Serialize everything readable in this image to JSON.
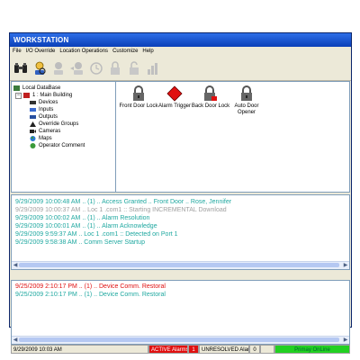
{
  "window": {
    "title": "WORKSTATION"
  },
  "menu": [
    "File",
    "I/O Override",
    "Location Operations",
    "Customize",
    "Help"
  ],
  "toolbar": {
    "buttons": [
      "binoculars-icon",
      "search-person-icon",
      "person-gear-icon",
      "person-arrow-icon",
      "clock-icon",
      "lock-icon",
      "lock-open-icon",
      "chart-icon"
    ]
  },
  "tree": {
    "root": "Local DataBase",
    "building": "1 : Main Building",
    "items": [
      "Devices",
      "Inputs",
      "Outputs",
      "Override Groups",
      "Cameras",
      "Maps",
      "Operator Comment"
    ]
  },
  "devices": [
    {
      "label": "Front Door Lock",
      "icon": "padlock-icon"
    },
    {
      "label": "Alarm Trigger",
      "icon": "alarm-diamond-icon"
    },
    {
      "label": "Back Door Lock",
      "icon": "padlock-alarm-icon"
    },
    {
      "label": "Auto Door Opener",
      "icon": "padlock-icon"
    }
  ],
  "events": [
    {
      "text": "9/29/2009 10:00:48 AM .. (1) .. Access Granted .. Front Door .. Rose, Jennifer",
      "color": "#1fa8a0"
    },
    {
      "text": "9/29/2009 10:00:37 AM .. Loc 1 .com1 :: Starting INCREMENTAL Download",
      "color": "#a0a0a0"
    },
    {
      "text": "9/29/2009 10:00:02 AM .. (1) .. Alarm Resolution",
      "color": "#1fa8a0"
    },
    {
      "text": "9/29/2009 10:00:01 AM .. (1) .. Alarm Acknowledge",
      "color": "#1fa8a0"
    },
    {
      "text": "9/29/2009 9:59:37 AM .. Loc 1 .com1 :: Detected on Port 1",
      "color": "#1fa8a0"
    },
    {
      "text": "9/29/2009 9:58:38 AM .. Comm Server Startup",
      "color": "#1fa8a0"
    }
  ],
  "alarms": [
    {
      "text": "9/25/2009 2:10:17 PM .. (1) .. Device Comm. Restoral",
      "color": "#e01010"
    },
    {
      "text": "9/25/2009 2:10:17 PM .. (1) .. Device Comm. Restoral",
      "color": "#1fa8a0"
    }
  ],
  "status": {
    "datetime": "9/29/2009 10:03 AM",
    "active_alarms_label": "ACTIVE Alarms",
    "active_alarms_count": "1",
    "unresolved_label": "UNRESOLVED Alarms",
    "unresolved_count": "0",
    "online_label": "Primay OnLine"
  }
}
